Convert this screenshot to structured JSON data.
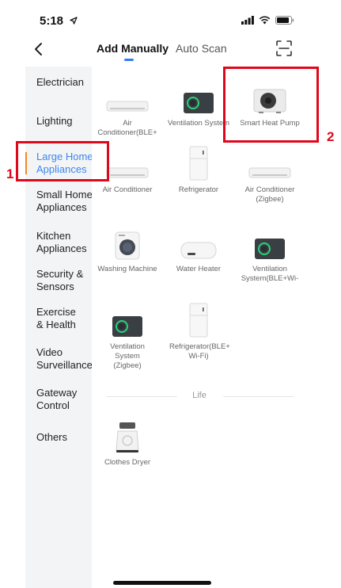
{
  "status_bar": {
    "time": "5:18"
  },
  "nav": {
    "tabs": [
      {
        "label": "Add Manually",
        "active": true
      },
      {
        "label": "Auto Scan",
        "active": false
      }
    ]
  },
  "sidebar": {
    "items": [
      {
        "label": "Electrician",
        "active": false
      },
      {
        "label": "Lighting",
        "active": false
      },
      {
        "label": "Large Home Appliances",
        "active": true
      },
      {
        "label": "Small Home Appliances",
        "active": false
      },
      {
        "label": "Kitchen Appliances",
        "active": false
      },
      {
        "label": "Security & Sensors",
        "active": false
      },
      {
        "label": "Exercise & Health",
        "active": false
      },
      {
        "label": "Video Surveillance",
        "active": false
      },
      {
        "label": "Gateway Control",
        "active": false
      },
      {
        "label": "Others",
        "active": false
      }
    ]
  },
  "devices": [
    {
      "label": "Air Conditioner(BLE+",
      "icon": "ac-unit-icon"
    },
    {
      "label": "Ventilation System",
      "icon": "ventilation-icon"
    },
    {
      "label": "Smart Heat Pump",
      "icon": "heat-pump-icon"
    },
    {
      "label": "Air Conditioner",
      "icon": "ac-unit-icon"
    },
    {
      "label": "Refrigerator",
      "icon": "refrigerator-icon"
    },
    {
      "label": "Air Conditioner (Zigbee)",
      "icon": "ac-unit-icon"
    },
    {
      "label": "Washing Machine",
      "icon": "washing-machine-icon"
    },
    {
      "label": "Water Heater",
      "icon": "water-heater-icon"
    },
    {
      "label": "Ventilation System(BLE+Wi-",
      "icon": "ventilation-icon"
    },
    {
      "label": "Ventilation System (Zigbee)",
      "icon": "ventilation-icon"
    },
    {
      "label": "Refrigerator(BLE+ Wi-Fi)",
      "icon": "refrigerator-icon"
    }
  ],
  "section": {
    "label": "Life"
  },
  "life_devices": [
    {
      "label": "Clothes Dryer",
      "icon": "clothes-dryer-icon"
    }
  ],
  "annotations": [
    {
      "number": "1",
      "target": "Large Home Appliances"
    },
    {
      "number": "2",
      "target": "Smart Heat Pump"
    }
  ],
  "colors": {
    "accent": "#3b86f0",
    "marker": "#f08a24",
    "annotation": "#e1071b",
    "sidebar_bg": "#f3f4f6"
  }
}
